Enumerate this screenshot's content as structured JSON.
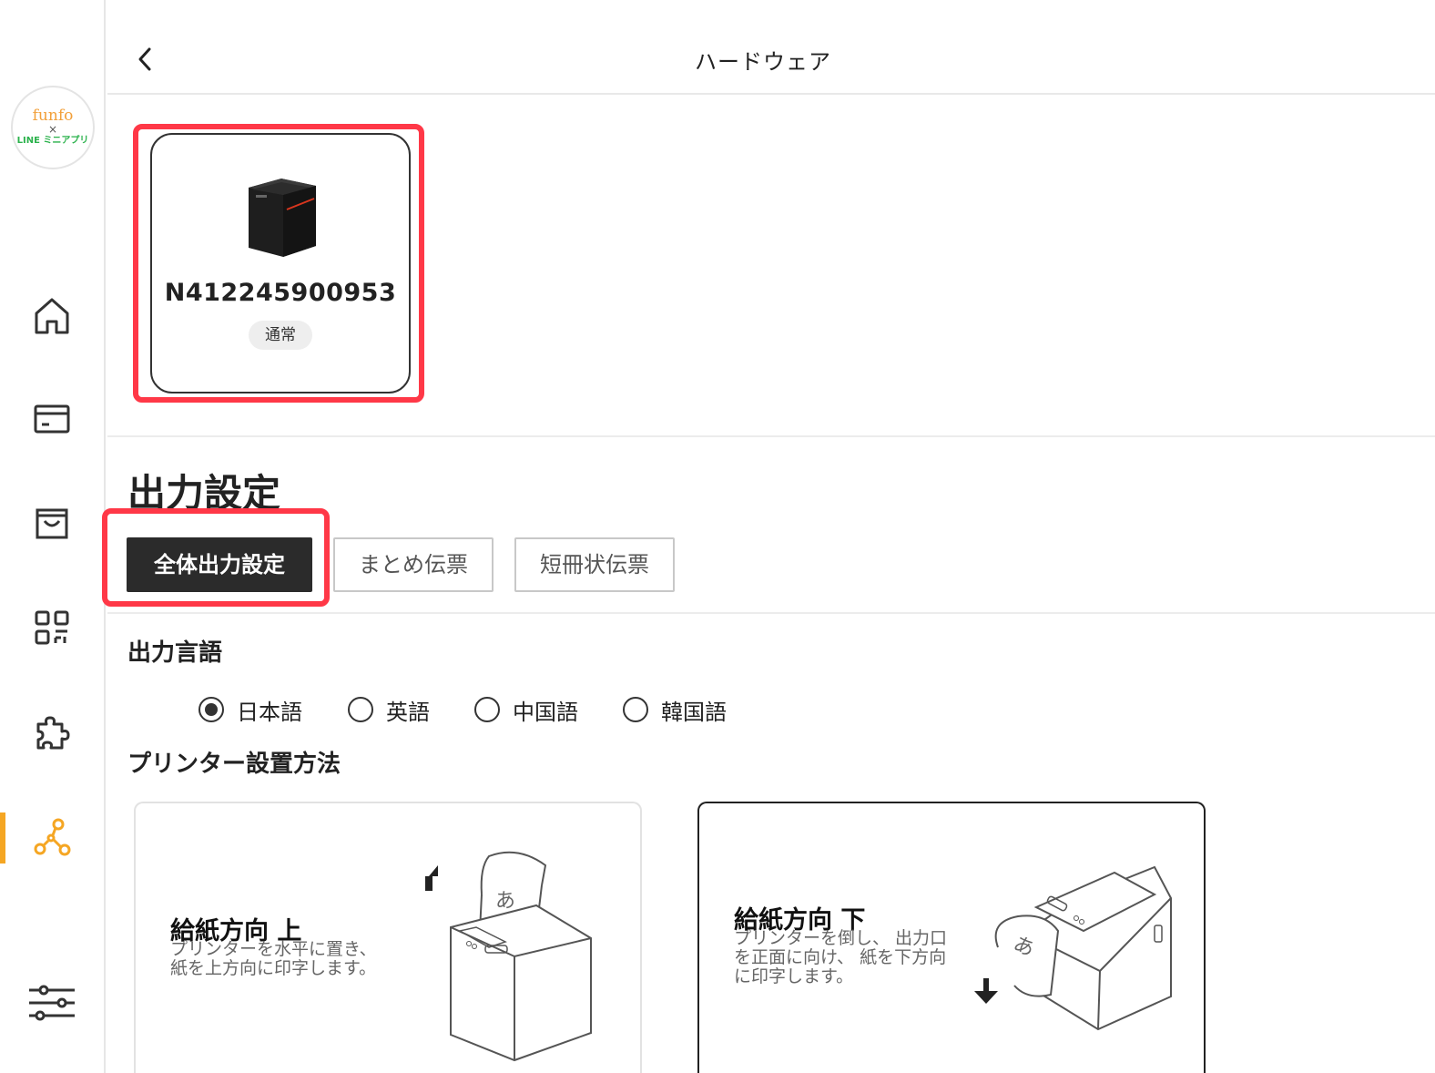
{
  "sidebar": {
    "logo": {
      "line1": "funfo",
      "line2": "×",
      "line3": "LINE ミニアプリ"
    },
    "items": [
      {
        "icon": "home-icon"
      },
      {
        "icon": "card-icon"
      },
      {
        "icon": "shopping-bag-icon"
      },
      {
        "icon": "qr-code-icon"
      },
      {
        "icon": "puzzle-icon"
      },
      {
        "icon": "network-icon",
        "active": true
      },
      {
        "icon": "settings-sliders-icon"
      }
    ],
    "accent_color": "#f5a623"
  },
  "header": {
    "title": "ハードウェア",
    "back_icon": "chevron-left-icon"
  },
  "device": {
    "id": "N412245900953",
    "status": "通常",
    "highlight_color": "#ff3847"
  },
  "output": {
    "title": "出力設定",
    "tabs": [
      {
        "label": "全体出力設定",
        "active": true
      },
      {
        "label": "まとめ伝票",
        "active": false
      },
      {
        "label": "短冊状伝票",
        "active": false
      }
    ]
  },
  "language": {
    "title": "出力言語",
    "options": [
      {
        "label": "日本語",
        "selected": true
      },
      {
        "label": "英語",
        "selected": false
      },
      {
        "label": "中国語",
        "selected": false
      },
      {
        "label": "韓国語",
        "selected": false
      }
    ]
  },
  "placement": {
    "title": "プリンター設置方法",
    "options": [
      {
        "title": "給紙方向 上",
        "desc": "プリンターを水平に置き、\n紙を上方向に印字します。",
        "glyph": "あ"
      },
      {
        "title": "給紙方向 下",
        "desc": "プリンターを倒し、 出力口\nを正面に向け、 紙を下方向\nに印字します。",
        "glyph": "あ",
        "selected": true
      }
    ]
  }
}
